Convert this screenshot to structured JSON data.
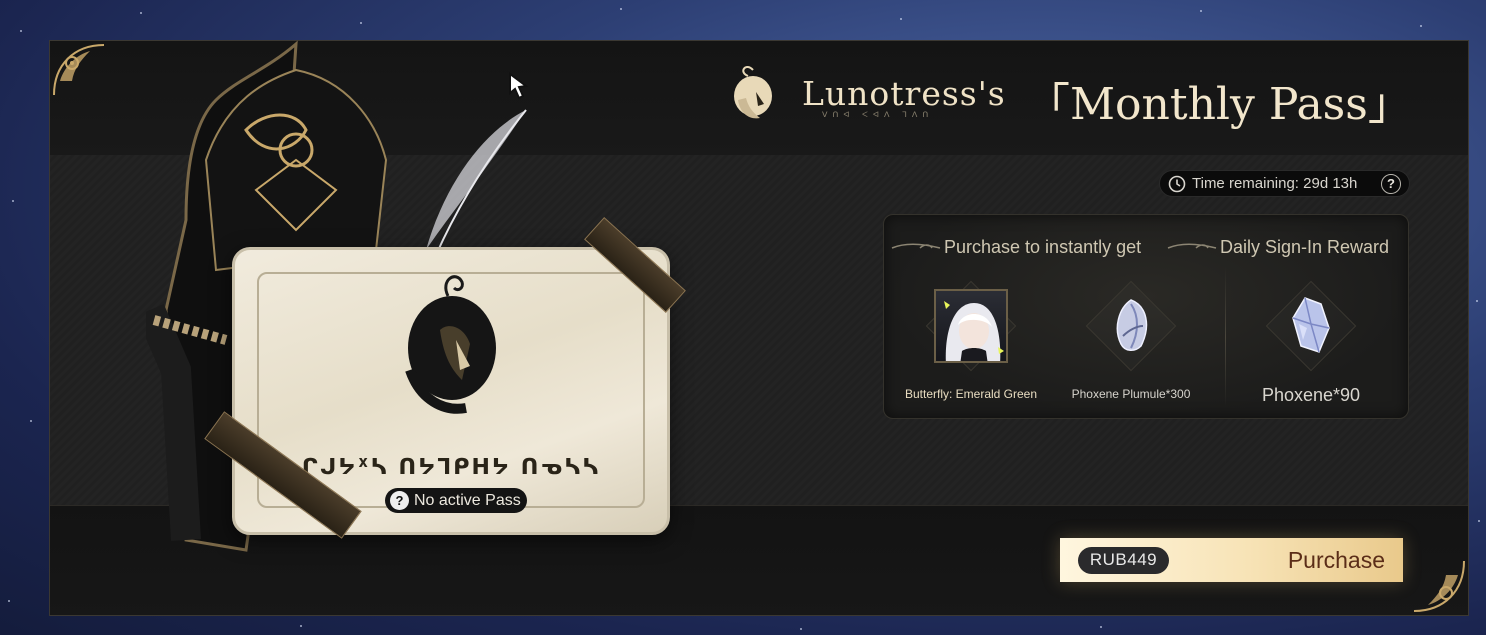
{
  "header": {
    "character_name": "Lunotress's",
    "name_runes": "ᐯᑎᐊ ᐸᐊᐱ ᒣᐱᑎ",
    "open_bracket": "「",
    "title": "Monthly Pass",
    "close_bracket": "」",
    "icon": "character-head-icon"
  },
  "timer": {
    "icon": "clock-icon",
    "text": "Time remaining: 29d 13h",
    "help_icon": "question-icon",
    "help_glyph": "?"
  },
  "rewards": {
    "instant_heading": "Purchase to instantly get",
    "daily_heading": "Daily Sign-In Reward",
    "instant_items": [
      {
        "label": "Butterfly: Emerald Green",
        "icon": "character-portrait-icon"
      },
      {
        "label": "Phoxene Plumule*300",
        "icon": "plumule-crystal-icon"
      }
    ],
    "daily_items": [
      {
        "label": "Phoxene*90",
        "icon": "phoxene-crystal-icon"
      }
    ]
  },
  "card": {
    "rune_title": "ᒋᒍᔭᕽᓴ ᑎᔭᒣᑭᕼᔭ ᑎᓀᓴᓴ",
    "status_icon": "question-icon",
    "status_glyph": "?",
    "status_text": "No active Pass"
  },
  "purchase": {
    "price": "RUB449",
    "label": "Purchase"
  },
  "colors": {
    "accent_gold": "#c9a86a",
    "title_text": "#f2e6cc",
    "purchase_text": "#5b2d18"
  }
}
